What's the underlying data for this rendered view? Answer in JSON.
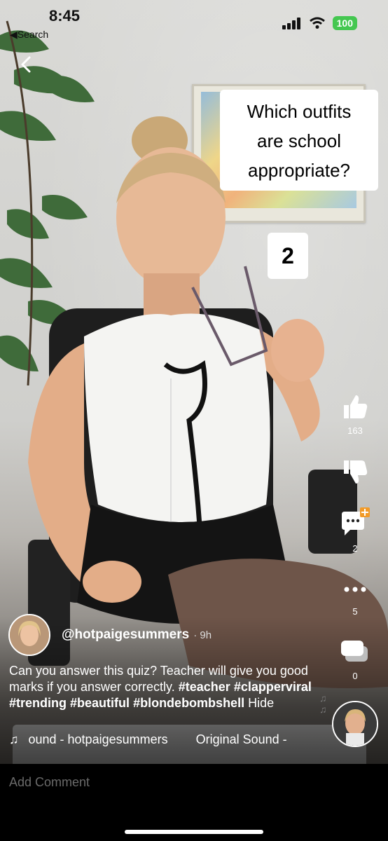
{
  "status": {
    "time": "8:45",
    "back_label": "Search",
    "battery": "100"
  },
  "overlay": {
    "quiz_lines": [
      "Which outfits",
      "are school",
      "appropriate?"
    ],
    "number": "2"
  },
  "actions": {
    "like_count": "163",
    "comment_count": "2",
    "more_count": "5",
    "share_count": "0"
  },
  "post": {
    "username": "@hotpaigesummers",
    "time": "· 9h",
    "caption_text": "Can you answer this quiz? Teacher will give you good marks if you answer correctly.",
    "hashtags": [
      "#teacher",
      "#clapperviral",
      "#trending",
      "#beautiful",
      "#blondebombshell"
    ],
    "hide_label": "Hide",
    "sound_label": "ound - hotpaigesummers",
    "sound_original": "Original Sound -"
  },
  "comment": {
    "placeholder": "Add Comment"
  }
}
